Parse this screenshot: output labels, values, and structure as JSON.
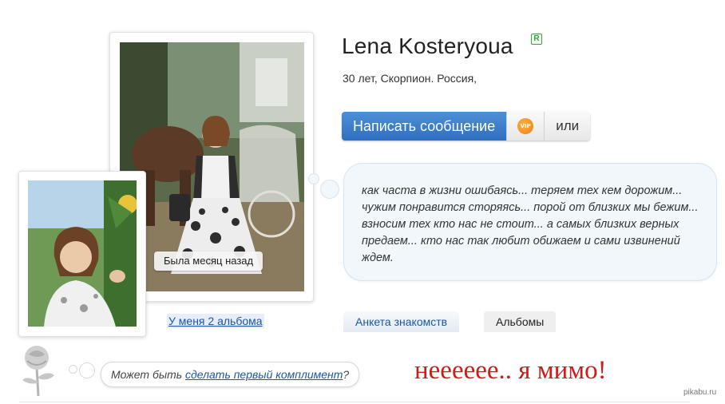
{
  "profile": {
    "name": "Lena Kosteryoua",
    "verified_badge": "R",
    "info": "30 лет, Скорпион. Россия,"
  },
  "actions": {
    "message_label": "Написать сообщение",
    "vip_icon_text": "VIP",
    "or_label": "или"
  },
  "status_text": "как часта в жизни ошибаясь... теряем тех кем дорожим... чужим понравится сторяясь... порой от близких мы бежим... взносим тех кто нас не стоит... а самых близких верных предаем... кто нас так любит обижаем и сами извинений ждем.",
  "photo": {
    "last_seen": "Была месяц назад",
    "albums_link": "У меня 2 альбома"
  },
  "tabs": [
    {
      "label": "Анкета знакомств"
    },
    {
      "label": "Альбомы"
    }
  ],
  "compliment": {
    "prefix": "Может быть ",
    "link": "сделать первый комплимент",
    "suffix": "?"
  },
  "overlay_caption": "нееееее.. я мимо!",
  "watermark": "pikabu.ru",
  "colors": {
    "accent_blue": "#2f6fbf",
    "link_blue": "#1a56a8",
    "caption_red": "#d21a1a",
    "cloud_bg": "#f2f7fc"
  }
}
